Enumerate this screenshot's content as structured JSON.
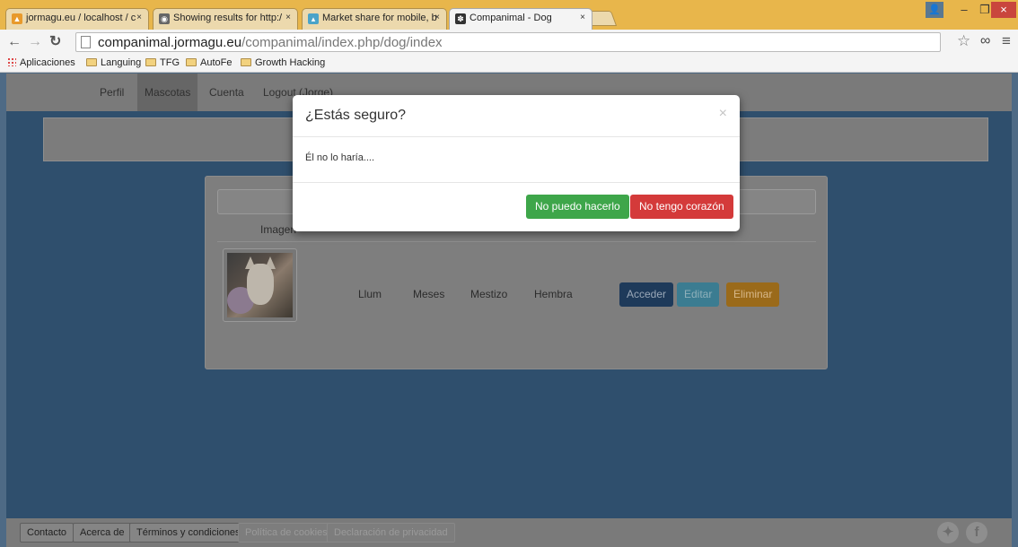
{
  "browser": {
    "tabs": [
      {
        "title": "jormagu.eu / localhost / c"
      },
      {
        "title": "Showing results for http:/"
      },
      {
        "title": "Market share for mobile, b"
      },
      {
        "title": "Companimal - Dog"
      }
    ],
    "url_host": "companimal.jormagu.eu",
    "url_path": "/companimal/index.php/dog/index",
    "bookmarks": [
      "Aplicaciones",
      "Languing",
      "TFG",
      "AutoFe",
      "Growth Hacking"
    ]
  },
  "nav": {
    "items": [
      {
        "label": "Perfil"
      },
      {
        "label": "Mascotas"
      },
      {
        "label": "Cuenta"
      },
      {
        "label": "Logout (Jorge)"
      }
    ]
  },
  "table": {
    "headers": [
      "Imagen"
    ],
    "row": {
      "name": "Llum",
      "age": "Meses",
      "breed": "Mestizo",
      "sex": "Hembra",
      "actions": [
        "Acceder",
        "Editar",
        "Eliminar"
      ]
    }
  },
  "modal": {
    "title": "¿Estás seguro?",
    "close": "×",
    "body": "Él no lo haría....",
    "confirm": "No puedo hacerlo",
    "cancel": "No tengo corazón"
  },
  "footer": {
    "links": [
      "Contacto",
      "Acerca de",
      "Términos y condiciones",
      "Política de cookies",
      "Declaración de privacidad"
    ]
  },
  "colors": {
    "modal_confirm": "#3ea64a",
    "modal_cancel": "#d43a3a",
    "titlebar": "#e8b64b"
  }
}
